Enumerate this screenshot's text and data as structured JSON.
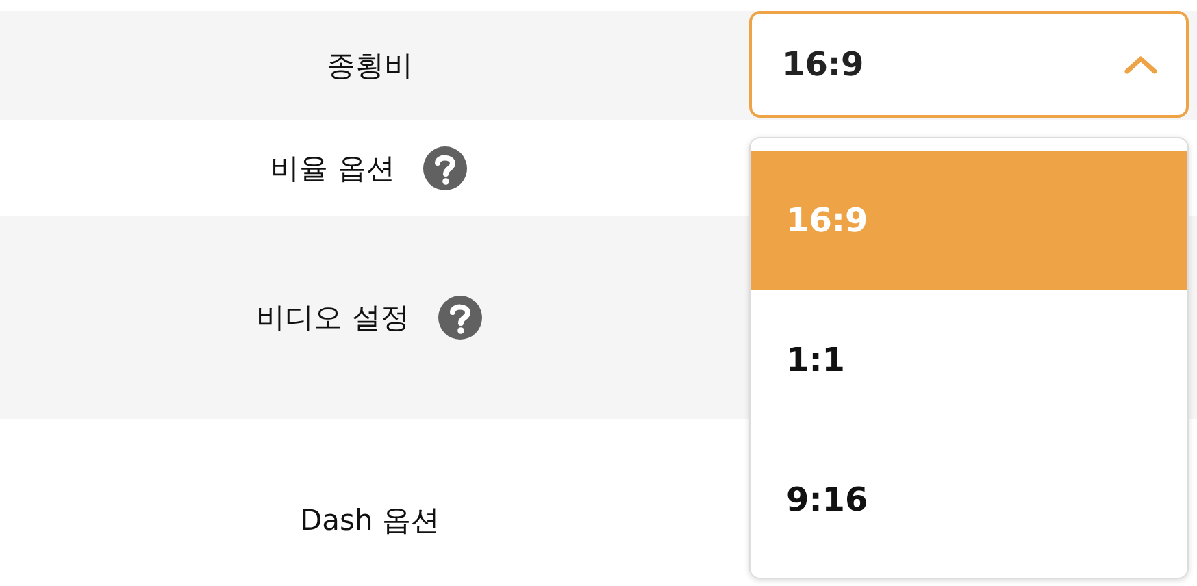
{
  "rows": [
    {
      "label": "종횡비",
      "help": false
    },
    {
      "label": "비율 옵션",
      "help": true
    },
    {
      "label": "비디오 설정",
      "help": true
    },
    {
      "label": "Dash 옵션",
      "help": false
    }
  ],
  "select": {
    "value": "16:9",
    "expanded": true,
    "options": [
      {
        "label": "16:9",
        "selected": true
      },
      {
        "label": "1:1",
        "selected": false
      },
      {
        "label": "9:16",
        "selected": false
      }
    ]
  }
}
